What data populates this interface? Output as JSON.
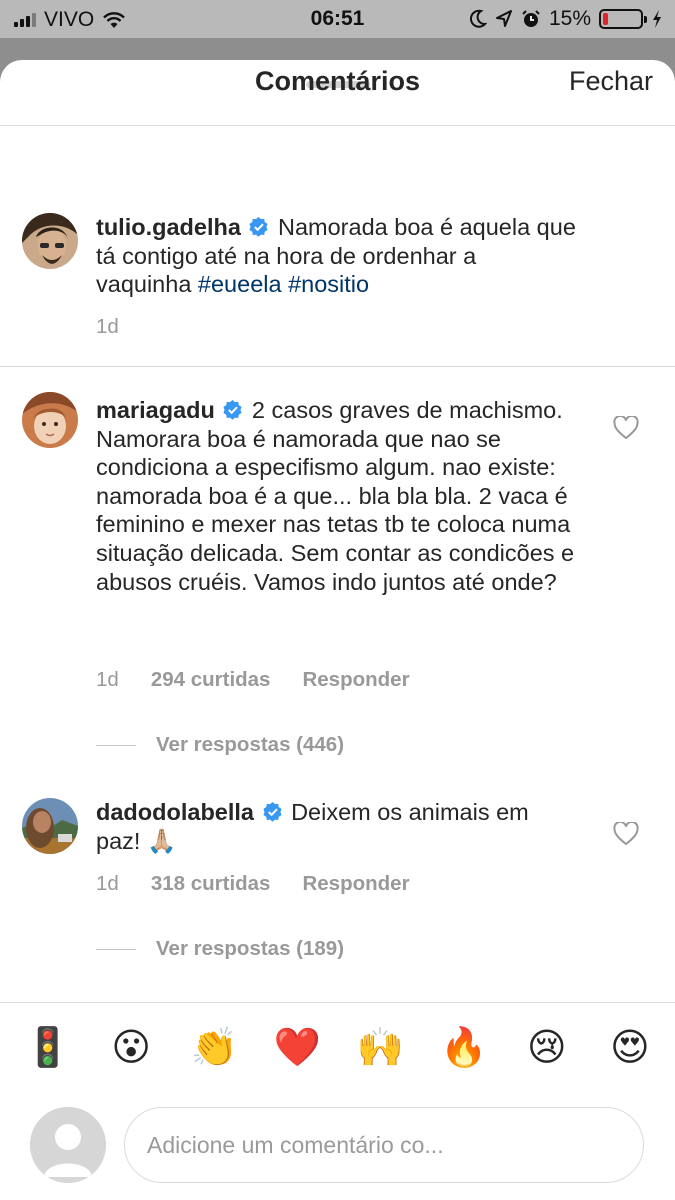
{
  "status_bar": {
    "carrier": "VIVO",
    "time": "06:51",
    "battery_percent": "15%",
    "battery_level": 0.15,
    "battery_color": "#e0242b",
    "icons": [
      "moon-icon",
      "location-icon",
      "alarm-icon",
      "charging-icon"
    ]
  },
  "header": {
    "title": "Comentários",
    "close_label": "Fechar"
  },
  "caption": {
    "username": "tulio.gadelha",
    "text_before": "Namorada boa é aquela que tá contigo até na hora de ordenhar a vaquinha",
    "hashtags": [
      "#eueela",
      "#nositio"
    ],
    "time": "1d"
  },
  "comments": [
    {
      "username": "mariagadu",
      "text": "2 casos graves de machismo. Namorara boa é namorada que nao se condiciona a especifismo algum. nao existe: namorada boa é a que... bla bla bla. 2 vaca é feminino e mexer nas tetas tb te coloca numa situação delicada. Sem contar as condicões e abusos cruéis. Vamos indo juntos até onde?",
      "time": "1d",
      "likes": "294 curtidas",
      "reply_label": "Responder",
      "view_replies": "Ver respostas (446)"
    },
    {
      "username": "dadodolabella",
      "text": "Deixem os animais em paz! 🙏🏼",
      "time": "1d",
      "likes": "318 curtidas",
      "reply_label": "Responder",
      "view_replies": "Ver respostas (189)"
    }
  ],
  "emoji_bar": [
    "🚦",
    "😮",
    "👏",
    "❤️",
    "🙌",
    "🔥",
    "😢",
    "😍"
  ],
  "comment_input": {
    "placeholder": "Adicione um comentário co..."
  },
  "colors": {
    "hashtag": "#003569",
    "verified": "#3897f0",
    "muted": "#999999"
  }
}
